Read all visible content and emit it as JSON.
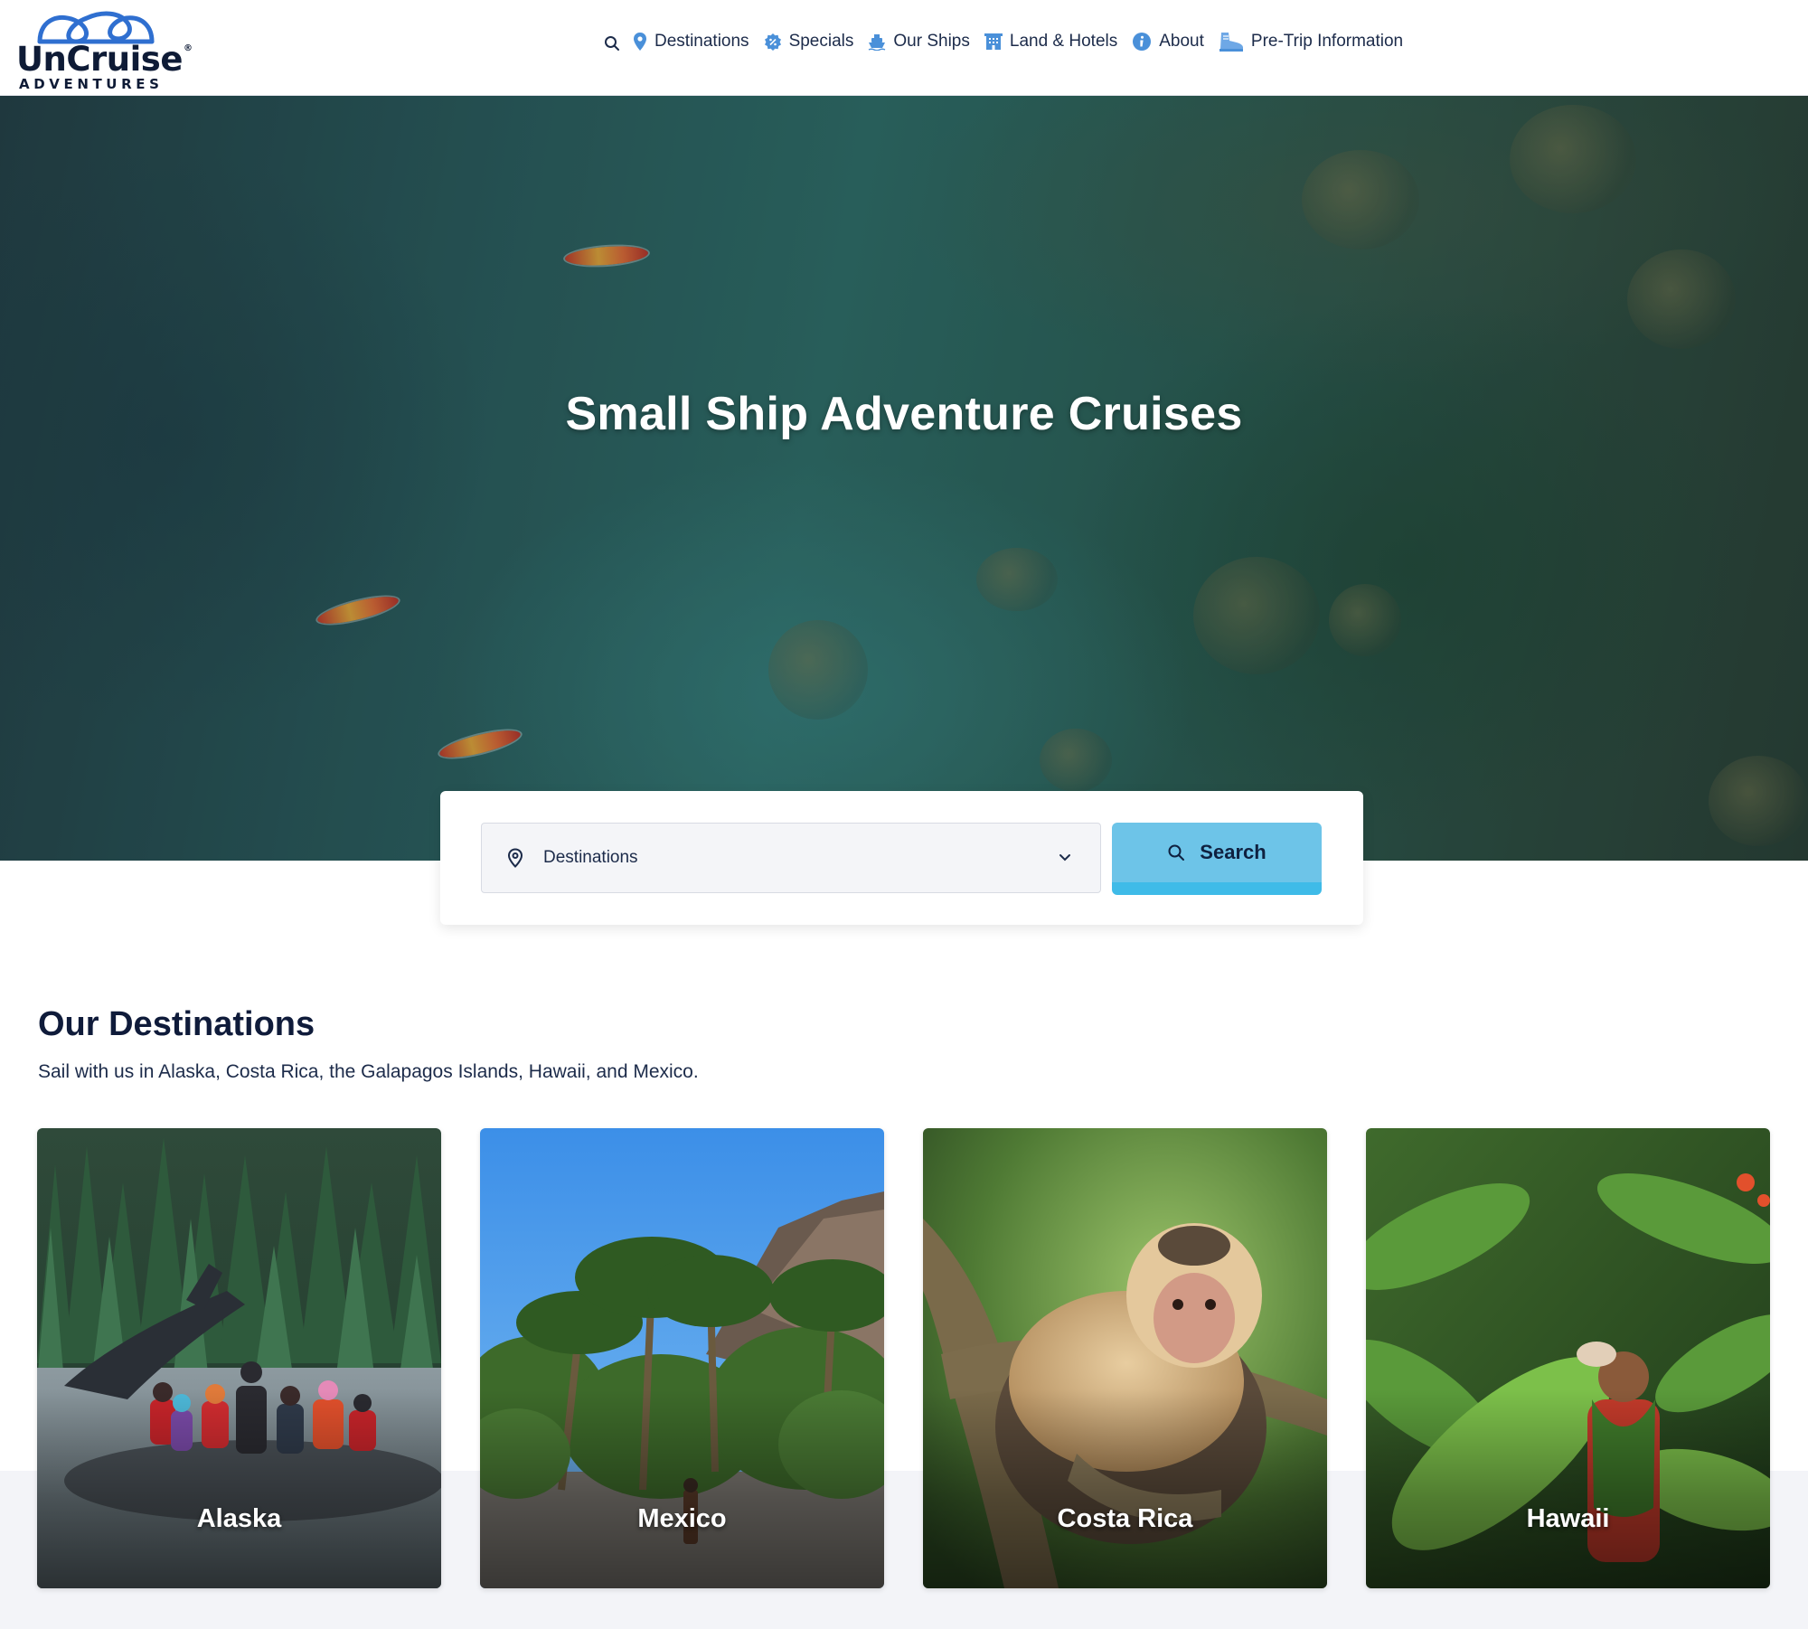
{
  "brand": {
    "wordmark": "UnCruise",
    "registered": "®",
    "tagline": "ADVENTURES"
  },
  "nav": {
    "items": [
      {
        "label": "Destinations",
        "icon": "map-pin-icon"
      },
      {
        "label": "Specials",
        "icon": "badge-percent-icon"
      },
      {
        "label": "Our Ships",
        "icon": "ship-icon"
      },
      {
        "label": "Land & Hotels",
        "icon": "hotel-icon"
      },
      {
        "label": "About",
        "icon": "info-icon"
      },
      {
        "label": "Pre-Trip Information",
        "icon": "hiking-boot-icon"
      }
    ]
  },
  "hero": {
    "title": "Small Ship Adventure Cruises"
  },
  "search": {
    "destination_value": "Destinations",
    "button_label": "Search"
  },
  "destinations": {
    "title": "Our Destinations",
    "subtitle": "Sail with us in Alaska, Costa Rica, the Galapagos Islands, Hawaii, and Mexico.",
    "cards": [
      {
        "label": "Alaska"
      },
      {
        "label": "Mexico"
      },
      {
        "label": "Costa Rica"
      },
      {
        "label": "Hawaii"
      }
    ]
  },
  "colors": {
    "accent": "#6dc4e8",
    "accent_dark": "#3fbbe8",
    "nav_icon": "#4a90d9",
    "text": "#1c2b4a",
    "heading": "#0f1b3a"
  }
}
